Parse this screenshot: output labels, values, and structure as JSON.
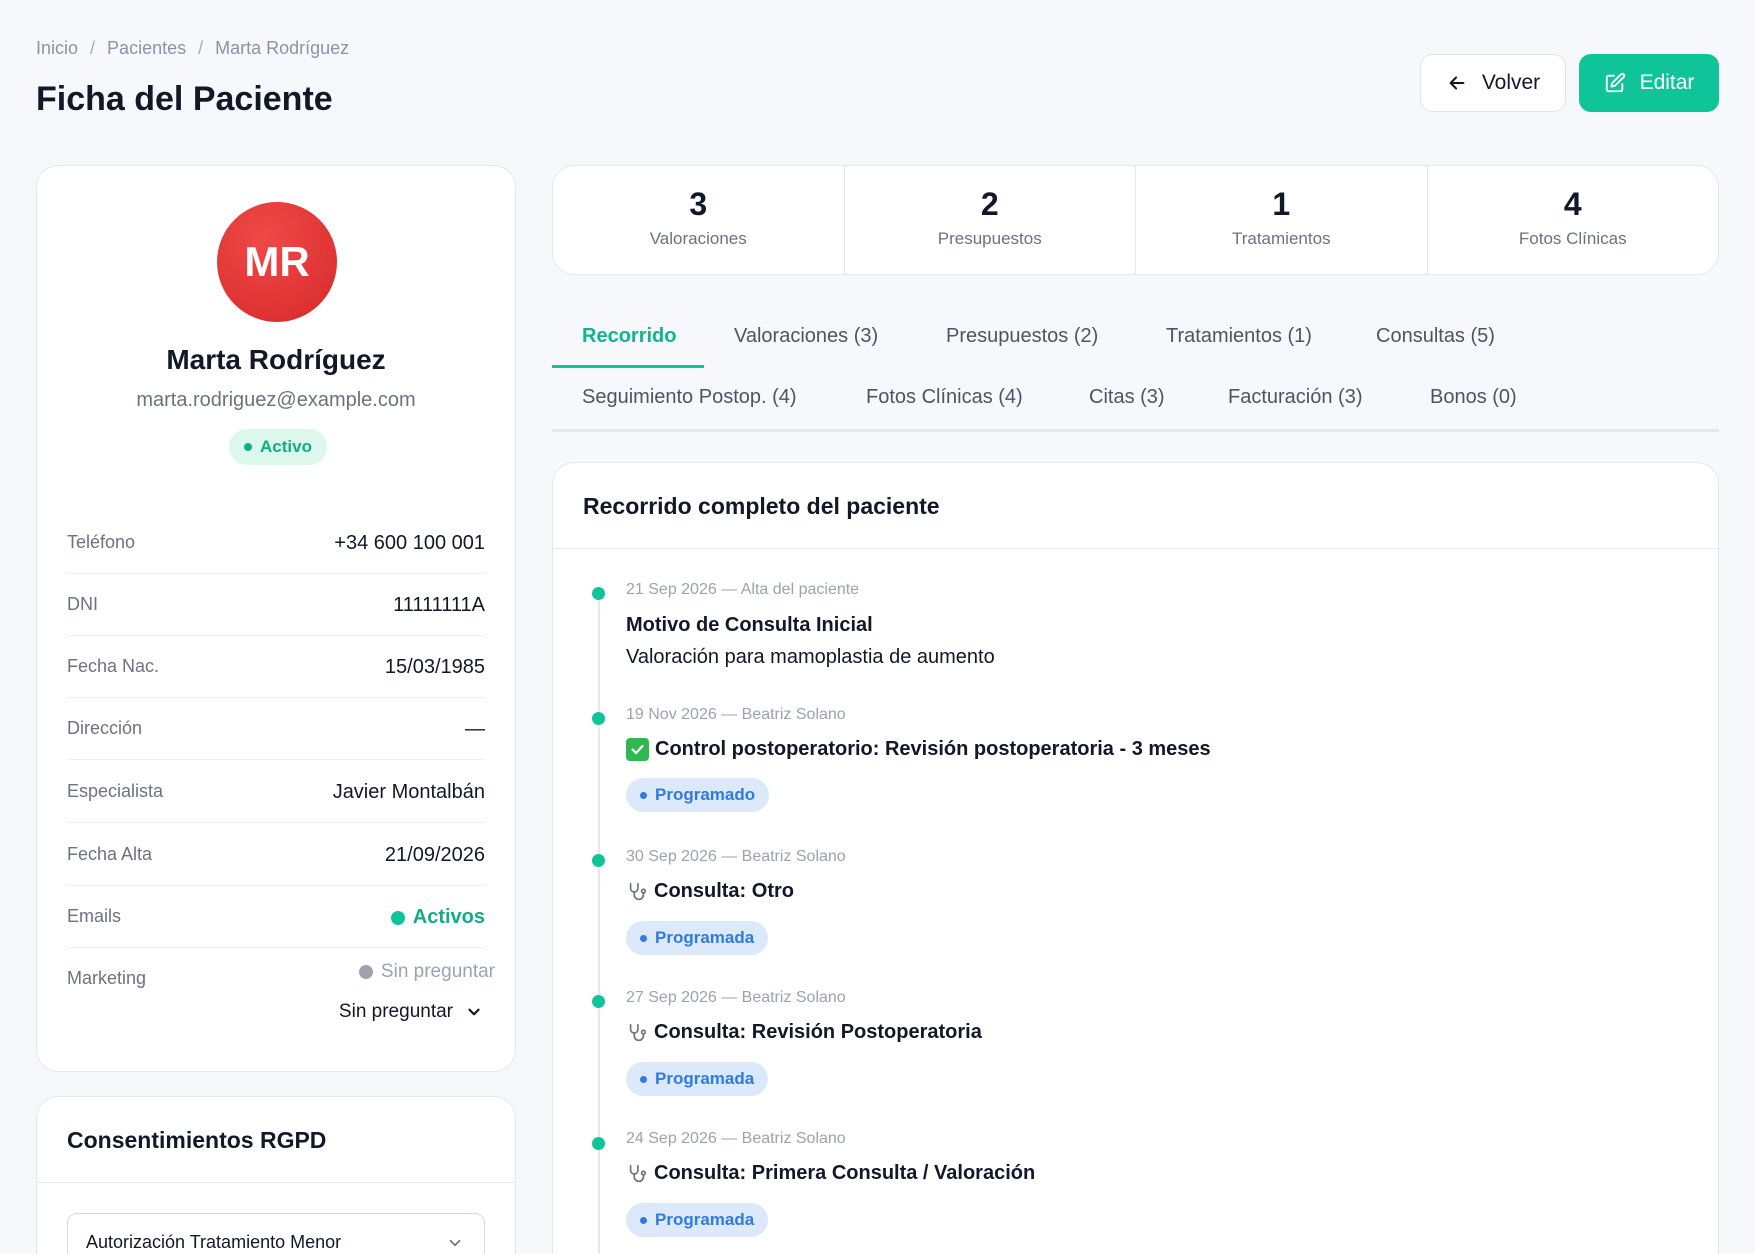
{
  "breadcrumb": {
    "home": "Inicio",
    "section": "Pacientes",
    "current": "Marta Rodríguez",
    "separator": "/"
  },
  "page": {
    "title": "Ficha del Paciente"
  },
  "actions": {
    "back_label": "Volver",
    "edit_label": "Editar"
  },
  "colors": {
    "accent": "#10c49a",
    "avatar": "#e03434",
    "pill_blue": "#2f7be0"
  },
  "patient": {
    "initials": "MR",
    "name": "Marta Rodríguez",
    "email": "marta.rodriguez@example.com",
    "status": "Activo",
    "fields": {
      "telefono": {
        "label": "Teléfono",
        "value": "+34 600 100 001"
      },
      "dni": {
        "label": "DNI",
        "value": "11111111A"
      },
      "nacimiento": {
        "label": "Fecha Nac.",
        "value": "15/03/1985"
      },
      "direccion": {
        "label": "Dirección",
        "value": "—"
      },
      "especialista": {
        "label": "Especialista",
        "value": "Javier Montalbán"
      },
      "alta": {
        "label": "Fecha Alta",
        "value": "21/09/2026"
      },
      "emails": {
        "label": "Emails",
        "value": "Activos"
      },
      "marketing": {
        "label": "Marketing",
        "status": "Sin preguntar",
        "select_value": "Sin preguntar"
      }
    }
  },
  "rgpd": {
    "title": "Consentimientos RGPD",
    "select_value": "Autorización Tratamiento Menor"
  },
  "stats": [
    {
      "value": "3",
      "label": "Valoraciones"
    },
    {
      "value": "2",
      "label": "Presupuestos"
    },
    {
      "value": "1",
      "label": "Tratamientos"
    },
    {
      "value": "4",
      "label": "Fotos Clínicas"
    }
  ],
  "tabs": {
    "recorrido": "Recorrido",
    "valoraciones": "Valoraciones (3)",
    "presupuestos": "Presupuestos (2)",
    "tratamientos": "Tratamientos (1)",
    "consultas": "Consultas (5)",
    "seguimiento": "Seguimiento Postop. (4)",
    "fotos": "Fotos Clínicas (4)",
    "citas": "Citas (3)",
    "facturacion": "Facturación (3)",
    "bonos": "Bonos (0)"
  },
  "timeline": {
    "title": "Recorrido completo del paciente",
    "items": [
      {
        "meta": "21 Sep 2026 — Alta del paciente",
        "title": "Motivo de Consulta Inicial",
        "desc": "Valoración para mamoplastia de aumento",
        "icon": "none"
      },
      {
        "meta": "19 Nov 2026 — Beatriz Solano",
        "title": "Control postoperatorio: Revisión postoperatoria - 3 meses",
        "status": "Programado",
        "icon": "check-icon"
      },
      {
        "meta": "30 Sep 2026 — Beatriz Solano",
        "title": "Consulta: Otro",
        "status": "Programada",
        "icon": "stethoscope-icon"
      },
      {
        "meta": "27 Sep 2026 — Beatriz Solano",
        "title": "Consulta: Revisión Postoperatoria",
        "status": "Programada",
        "icon": "stethoscope-icon"
      },
      {
        "meta": "24 Sep 2026 — Beatriz Solano",
        "title": "Consulta: Primera Consulta / Valoración",
        "status": "Programada",
        "icon": "stethoscope-icon"
      }
    ]
  }
}
